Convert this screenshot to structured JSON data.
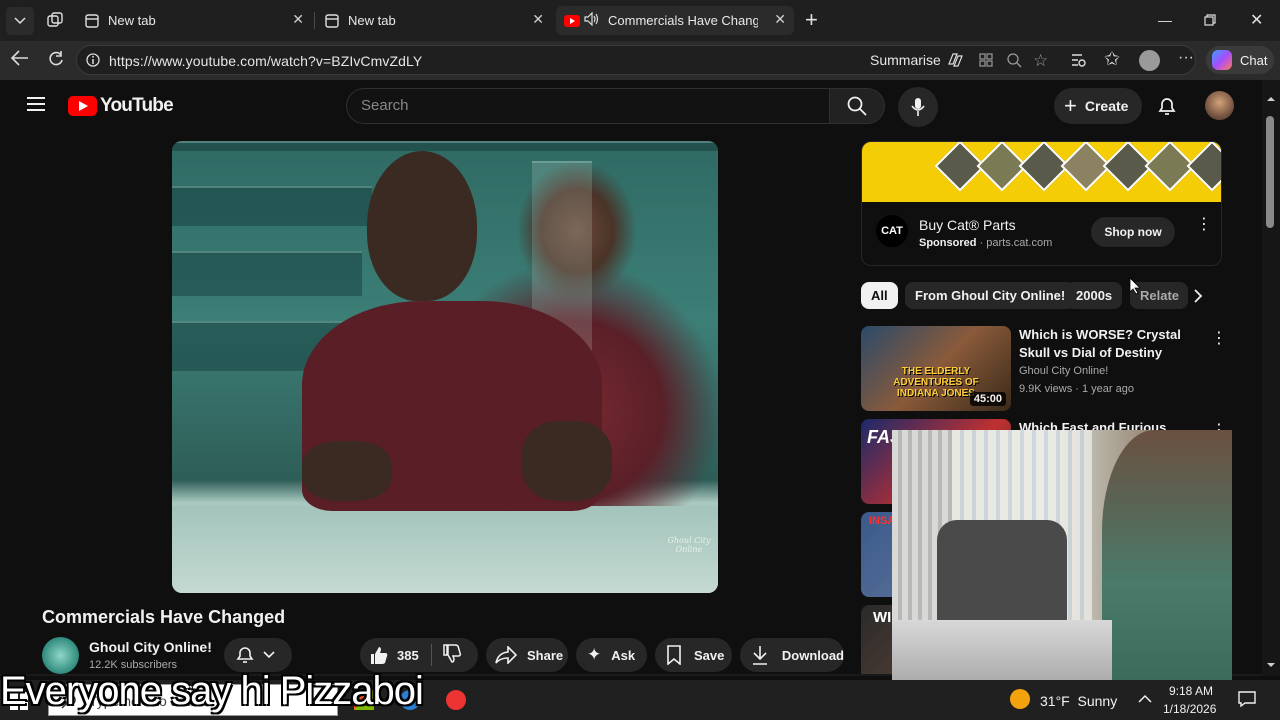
{
  "browser": {
    "tabs": [
      {
        "title": "New tab",
        "active": false
      },
      {
        "title": "New tab",
        "active": false
      },
      {
        "title": "Commercials Have Changed -",
        "active": true,
        "playing_audio": true
      }
    ],
    "url": "https://www.youtube.com/watch?v=BZIvCmvZdLY",
    "summarise_label": "Summarise",
    "chat_label": "Chat"
  },
  "youtube": {
    "logo_text": "YouTube",
    "search_placeholder": "Search",
    "create_label": "Create",
    "video": {
      "title": "Commercials Have Changed",
      "watermark": "Ghoul City Online",
      "channel_name": "Ghoul City Online!",
      "subscribers": "12.2K subscribers",
      "likes": "385",
      "share_label": "Share",
      "ask_label": "Ask",
      "save_label": "Save",
      "download_label": "Download"
    },
    "ad": {
      "logo": "CAT",
      "title": "Buy Cat® Parts",
      "sponsored": "Sponsored",
      "domain": "parts.cat.com",
      "cta": "Shop now"
    },
    "chips": [
      "All",
      "From Ghoul City Online!",
      "2000s",
      "Relate"
    ],
    "recommendations": [
      {
        "title": "Which is WORSE? Crystal Skull vs Dial of Destiny",
        "channel": "Ghoul City Online!",
        "stats": "9.9K views · 1 year ago",
        "duration": "45:00",
        "thumb_text": "THE ELDERLY ADVENTURES OF INDIANA JONES"
      },
      {
        "title": "Which Fast and Furious Video",
        "thumb_text": "FAST"
      },
      {
        "title": "",
        "thumb_text": "INSA"
      },
      {
        "title": "",
        "thumb_text": "WI"
      }
    ]
  },
  "taskbar": {
    "search_placeholder": "Type here to search",
    "weather": "31°F  Sunny",
    "time": "9:18 AM",
    "date": "1/18/2026"
  },
  "overlay_caption": "Everyone say hi Pizzaboi",
  "colors": {
    "youtube_red": "#ff0000",
    "bg": "#0f0f0f",
    "chip": "#272727",
    "cat_yellow": "#f4cd07"
  }
}
